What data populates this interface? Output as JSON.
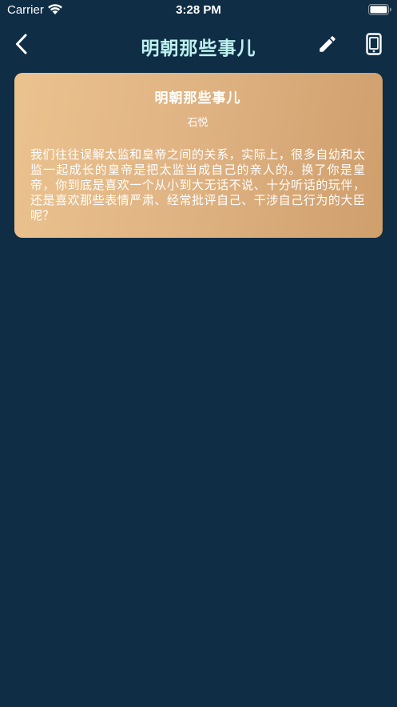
{
  "status_bar": {
    "carrier": "Carrier",
    "time": "3:28 PM"
  },
  "nav": {
    "title": "明朝那些事儿"
  },
  "card": {
    "title": "明朝那些事儿",
    "author": "石悦",
    "content": "我们往往误解太监和皇帝之间的关系，实际上，很多自幼和太监一起成长的皇帝是把太监当成自己的亲人的。换了你是皇帝，你到底是喜欢一个从小到大无话不说、十分听话的玩伴，还是喜欢那些表情严肃、经常批评自己、干涉自己行为的大臣呢？"
  },
  "colors": {
    "background": "#0f2d45",
    "title": "#bdf1ef",
    "card_gradient_start": "#ebc38f",
    "card_gradient_end": "#cf9f6c"
  },
  "icons": {
    "back": "chevron-left-icon",
    "edit": "pencil-icon",
    "phone": "phone-frame-icon",
    "wifi": "wifi-icon",
    "battery": "battery-icon"
  }
}
